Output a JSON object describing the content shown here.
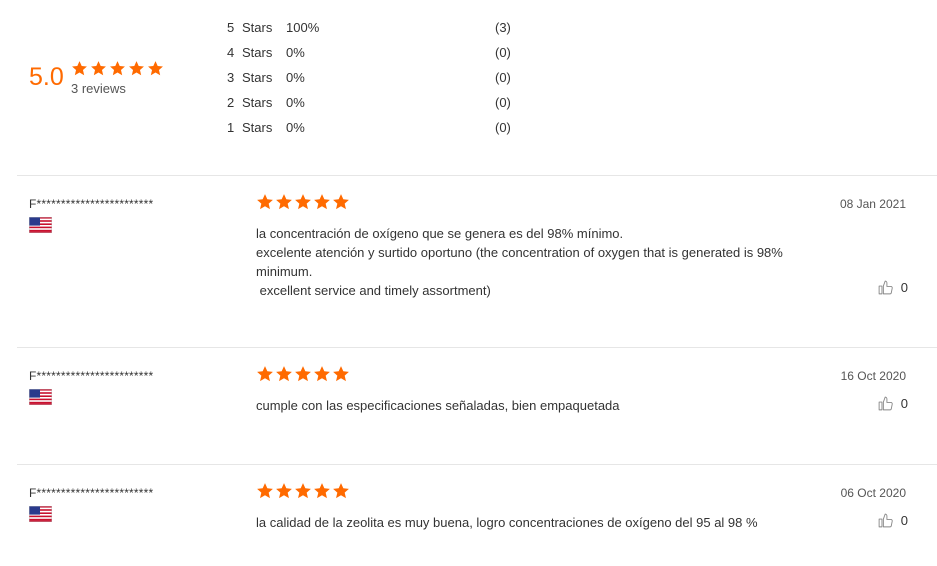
{
  "summary": {
    "average": "5.0",
    "reviews_count_label": "3 reviews",
    "average_stars": 5,
    "distribution": [
      {
        "num": "5",
        "label": "Stars",
        "percent": "100%",
        "count": "(3)"
      },
      {
        "num": "4",
        "label": "Stars",
        "percent": "0%",
        "count": "(0)"
      },
      {
        "num": "3",
        "label": "Stars",
        "percent": "0%",
        "count": "(0)"
      },
      {
        "num": "2",
        "label": "Stars",
        "percent": "0%",
        "count": "(0)"
      },
      {
        "num": "1",
        "label": "Stars",
        "percent": "0%",
        "count": "(0)"
      }
    ]
  },
  "reviews": [
    {
      "reviewer": "F************************",
      "country_flag": "us-flag-icon",
      "rating": 5,
      "date": "08 Jan 2021",
      "text_lines": [
        "la concentración de oxígeno que se genera es del 98% mínimo.",
        "excelente atención y surtido oportuno (the concentration of oxygen that is generated is 98%",
        "minimum.",
        " excellent service and timely assortment)"
      ],
      "helpful_count": "0"
    },
    {
      "reviewer": "F************************",
      "country_flag": "us-flag-icon",
      "rating": 5,
      "date": "16 Oct 2020",
      "text_lines": [
        "cumple con las especificaciones señaladas, bien empaquetada"
      ],
      "helpful_count": "0"
    },
    {
      "reviewer": "F************************",
      "country_flag": "us-flag-icon",
      "rating": 5,
      "date": "06 Oct 2020",
      "text_lines": [
        "la calidad de la zeolita es muy buena, logro concentraciones de oxígeno del 95 al 98 %"
      ],
      "helpful_count": "0"
    }
  ],
  "colors": {
    "star": "#ff6a00",
    "average": "#ff6a00",
    "divider": "#e6e6e6",
    "text": "#333333"
  }
}
